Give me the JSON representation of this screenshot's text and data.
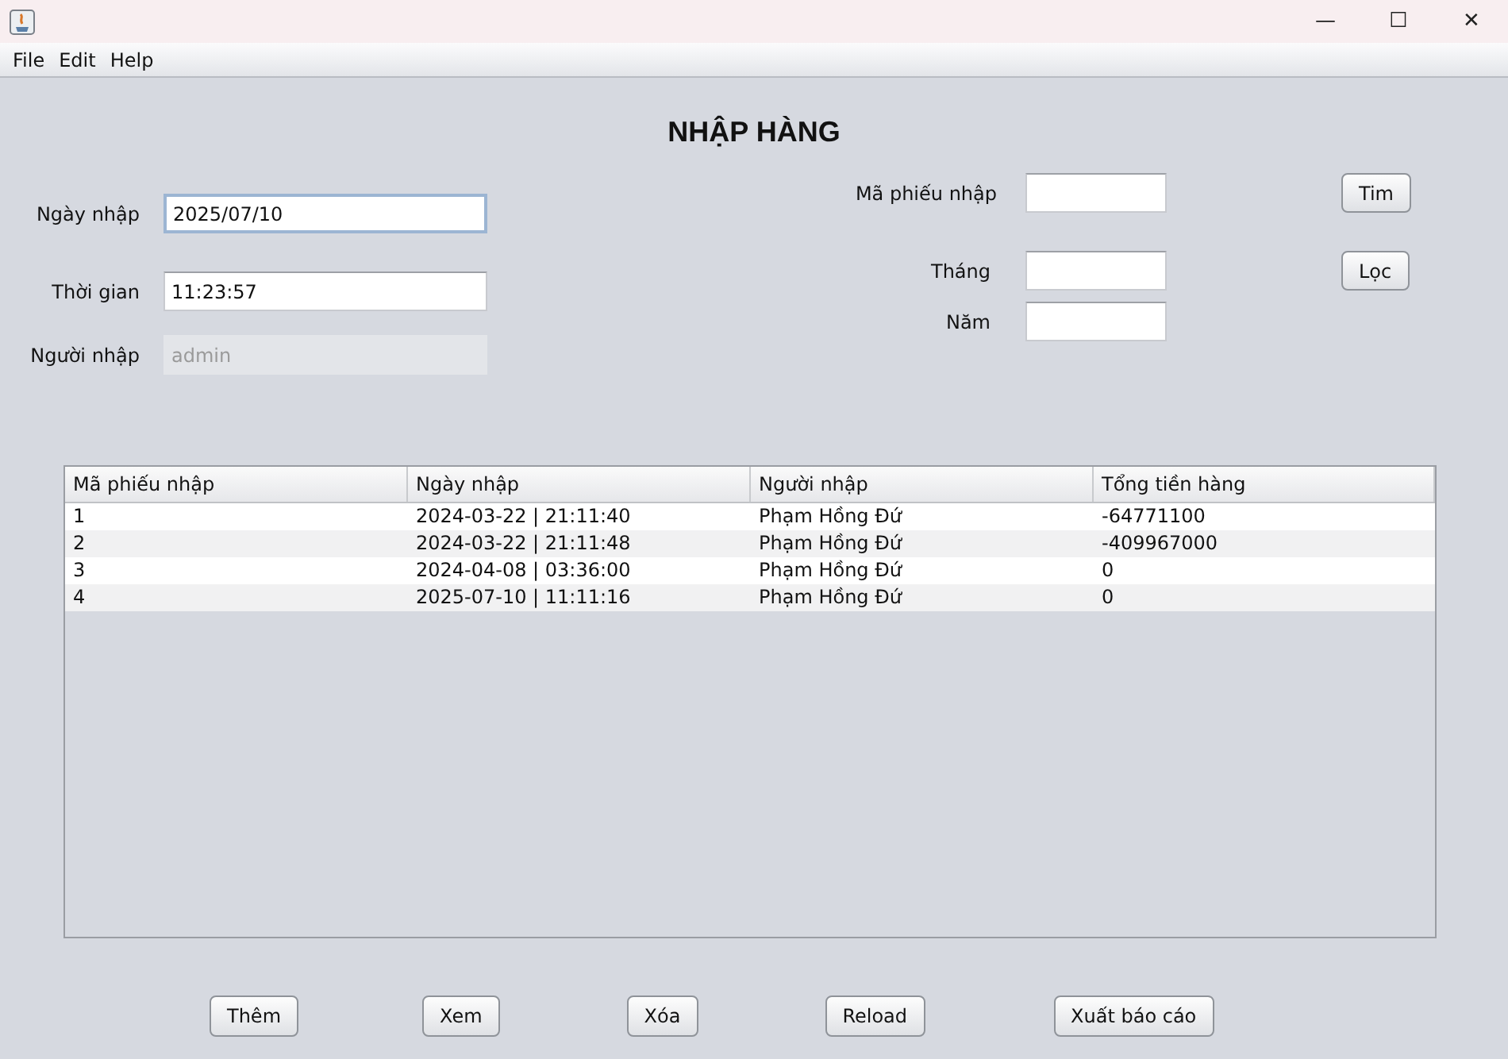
{
  "window": {
    "title_buttons": [
      "—",
      "☐",
      "✕"
    ]
  },
  "menu": [
    "File",
    "Edit",
    "Help"
  ],
  "heading": "NHẬP HÀNG",
  "left_fields": [
    {
      "label": "Ngày nhập",
      "value": "2025/07/10",
      "focused": true,
      "disabled": false
    },
    {
      "label": "Thời gian",
      "value": "11:23:57",
      "focused": false,
      "disabled": false
    },
    {
      "label": "Người nhập",
      "value": "admin",
      "focused": false,
      "disabled": true
    }
  ],
  "right_fields": [
    {
      "label": "Mã phiếu nhập",
      "button": "Tim"
    },
    {
      "label": "Tháng",
      "button": "Lọc"
    },
    {
      "label": "Năm"
    }
  ],
  "table": {
    "columns": [
      "Mã phiếu nhập",
      "Ngày nhập",
      "Người nhập",
      "Tổng tiền hàng"
    ],
    "rows": [
      [
        "1",
        "2024-03-22 | 21:11:40",
        "Phạm Hồng Đứ",
        "-64771100"
      ],
      [
        "2",
        "2024-03-22 | 21:11:48",
        "Phạm Hồng Đứ",
        "-409967000"
      ],
      [
        "3",
        "2024-04-08 | 03:36:00",
        "Phạm Hồng Đứ",
        "0"
      ],
      [
        "4",
        "2025-07-10 | 11:11:16",
        "Phạm Hồng Đứ",
        "0"
      ]
    ]
  },
  "buttons": [
    "Thêm",
    "Xem",
    "Xóa",
    "Reload",
    "Xuất báo cáo"
  ]
}
